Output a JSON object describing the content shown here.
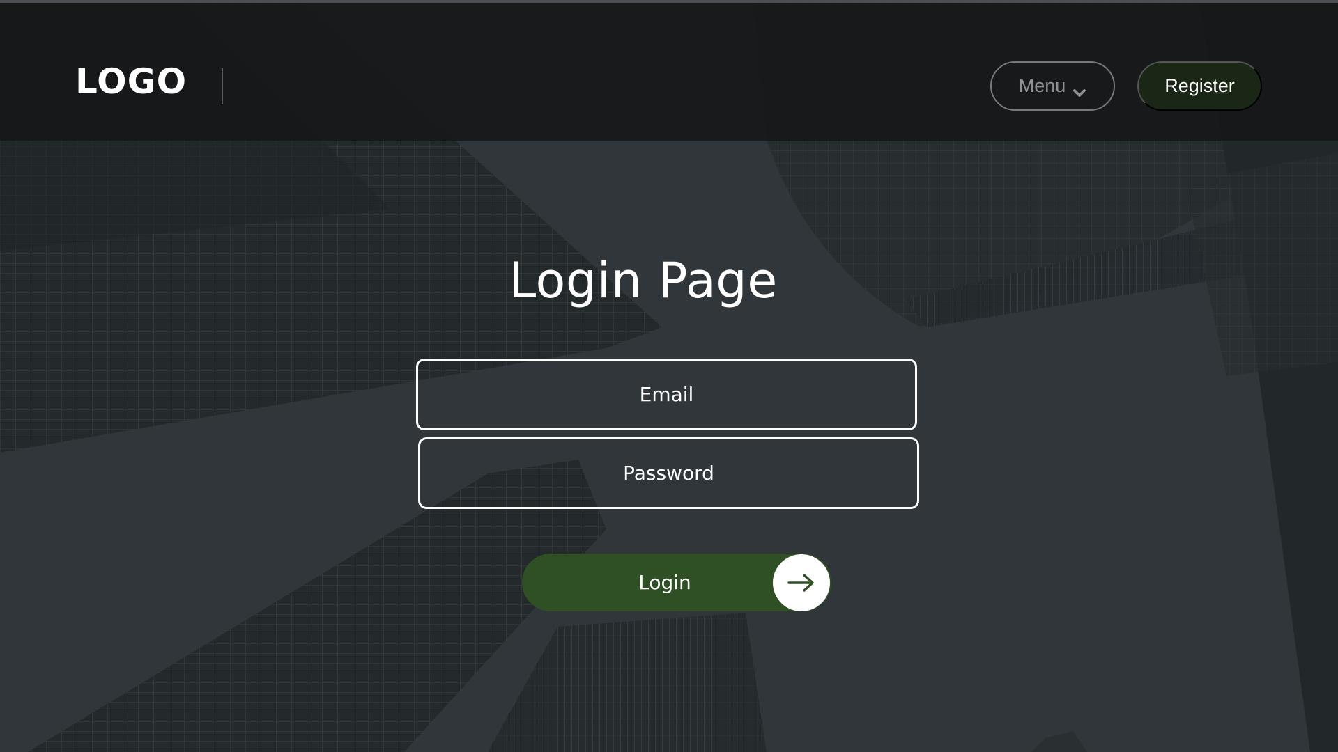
{
  "header": {
    "logo_text": "LOGO",
    "menu_label": "Menu",
    "register_label": "Register"
  },
  "main": {
    "title": "Login Page",
    "email_placeholder": "Email",
    "password_placeholder": "Password",
    "login_label": "Login"
  },
  "icons": {
    "menu_chevron": "chevron-down-icon",
    "login_arrow": "arrow-right-icon"
  },
  "colors": {
    "background": "#33383d",
    "topbar": "#161718",
    "register_button": "#1b2716",
    "login_button": "#2f5024",
    "text": "#ffffff"
  }
}
